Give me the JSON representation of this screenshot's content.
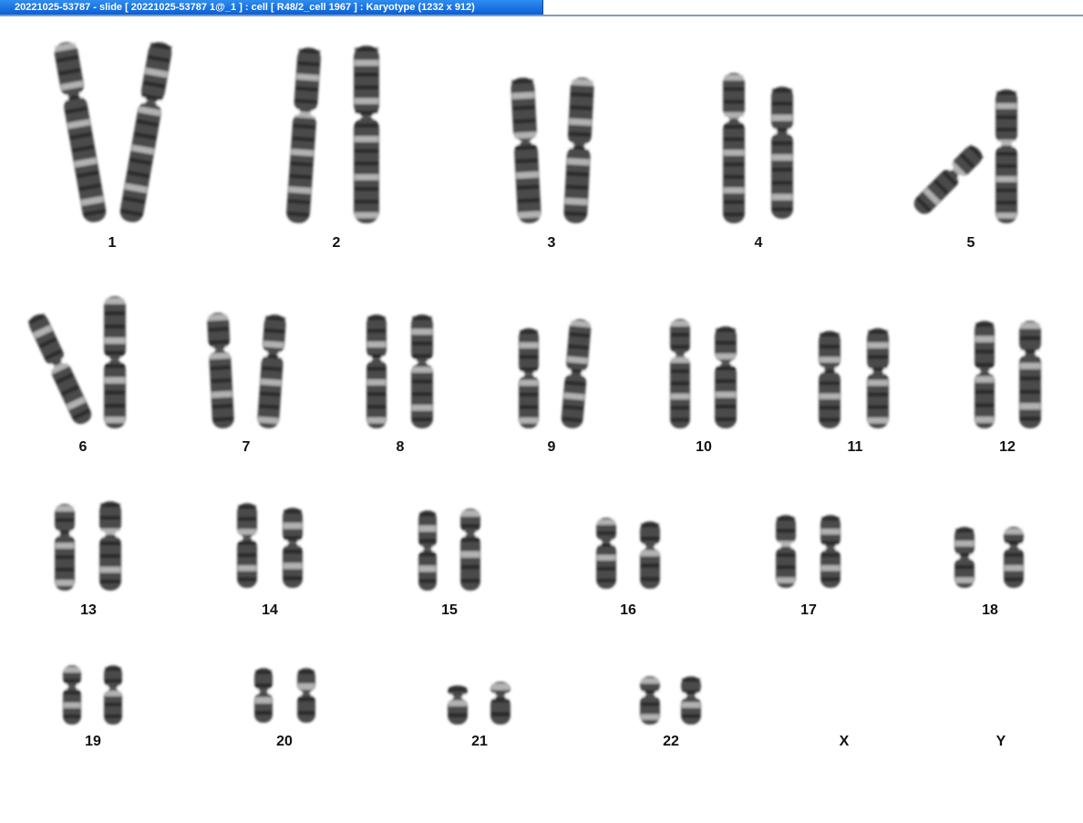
{
  "window": {
    "title": "20221025-53787 - slide [ 20221025-53787 1@_1 ] : cell [ R48/2_cell 1967 ] : Karyotype  (1232 x 912)"
  },
  "colors": {
    "title_bar": "#0a5fd6",
    "background": "#ffffff",
    "chromatin": "#2a2a2a",
    "band_dark": "#111111"
  },
  "karyotype": {
    "groups": [
      {
        "label": "1",
        "chromosomes": 2
      },
      {
        "label": "2",
        "chromosomes": 2
      },
      {
        "label": "3",
        "chromosomes": 2
      },
      {
        "label": "4",
        "chromosomes": 2
      },
      {
        "label": "5",
        "chromosomes": 2
      },
      {
        "label": "6",
        "chromosomes": 2
      },
      {
        "label": "7",
        "chromosomes": 2
      },
      {
        "label": "8",
        "chromosomes": 2
      },
      {
        "label": "9",
        "chromosomes": 2
      },
      {
        "label": "10",
        "chromosomes": 2
      },
      {
        "label": "11",
        "chromosomes": 2
      },
      {
        "label": "12",
        "chromosomes": 2
      },
      {
        "label": "13",
        "chromosomes": 2
      },
      {
        "label": "14",
        "chromosomes": 2
      },
      {
        "label": "15",
        "chromosomes": 2
      },
      {
        "label": "16",
        "chromosomes": 2
      },
      {
        "label": "17",
        "chromosomes": 2
      },
      {
        "label": "18",
        "chromosomes": 2
      },
      {
        "label": "19",
        "chromosomes": 2
      },
      {
        "label": "20",
        "chromosomes": 2
      },
      {
        "label": "21",
        "chromosomes": 2
      },
      {
        "label": "22",
        "chromosomes": 2
      },
      {
        "label": "X",
        "chromosomes": 0
      },
      {
        "label": "Y",
        "chromosomes": 0
      }
    ]
  }
}
